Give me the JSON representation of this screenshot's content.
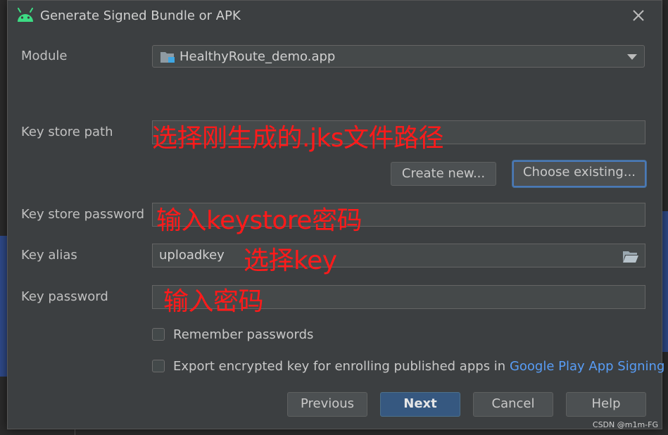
{
  "dialog": {
    "title": "Generate Signed Bundle or APK",
    "close_icon": "close-icon"
  },
  "module": {
    "label": "Module",
    "value": "HealthyRoute_demo.app"
  },
  "keystore_path": {
    "label": "Key store path",
    "value": "",
    "annotation": "选择刚生成的.jks文件路径"
  },
  "keystore_buttons": {
    "create_label": "Create new...",
    "choose_label": "Choose existing..."
  },
  "keystore_password": {
    "label": "Key store password",
    "annotation": "输入keystore密码"
  },
  "key_alias": {
    "label": "Key alias",
    "value": "uploadkey",
    "annotation": "选择key"
  },
  "key_password": {
    "label": "Key password",
    "annotation": "输入密码"
  },
  "checkboxes": {
    "remember": {
      "label": "Remember passwords",
      "checked": false
    },
    "export": {
      "label": "Export encrypted key for enrolling published apps in",
      "link": "Google Play App Signing",
      "checked": false
    }
  },
  "footer": {
    "previous_label": "Previous",
    "next_label": "Next",
    "cancel_label": "Cancel",
    "help_label": "Help"
  },
  "watermark": "CSDN @m1m-FG",
  "colors": {
    "dialog_bg": "#3c3f41",
    "annotation": "#ff1a1a",
    "link": "#589df6",
    "primary_button": "#365880"
  }
}
